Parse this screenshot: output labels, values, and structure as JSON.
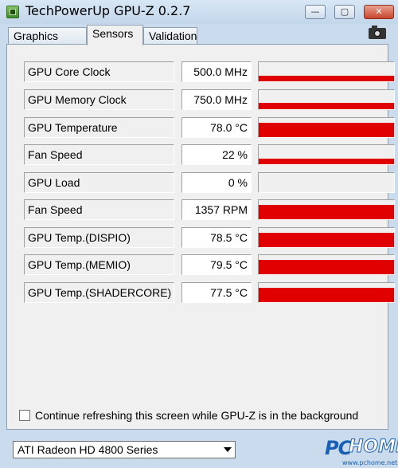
{
  "window": {
    "title": "TechPowerUp GPU-Z 0.2.7",
    "controls": {
      "minimize": "—",
      "maximize": "▢",
      "close": "✕"
    }
  },
  "tabs": [
    {
      "label": "Graphics Card",
      "active": false
    },
    {
      "label": "Sensors",
      "active": true
    },
    {
      "label": "Validation",
      "active": false
    }
  ],
  "icons": {
    "app": "gpu-z-app-icon",
    "screenshot": "camera-icon"
  },
  "sensors": [
    {
      "label": "GPU Core Clock",
      "value": "500.0 MHz",
      "graph_level": 0.3
    },
    {
      "label": "GPU Memory Clock",
      "value": "750.0 MHz",
      "graph_level": 0.35
    },
    {
      "label": "GPU Temperature",
      "value": "78.0 °C",
      "graph_level": 0.75
    },
    {
      "label": "Fan Speed",
      "value": "22 %",
      "graph_level": 0.3
    },
    {
      "label": "GPU Load",
      "value": "0 %",
      "graph_level": 0
    },
    {
      "label": "Fan Speed",
      "value": "1357 RPM",
      "graph_level": 0.75
    },
    {
      "label": "GPU Temp.(DISPIO)",
      "value": "78.5 °C",
      "graph_level": 0.75
    },
    {
      "label": "GPU Temp.(MEMIO)",
      "value": "79.5 °C",
      "graph_level": 0.75
    },
    {
      "label": "GPU Temp.(SHADERCORE)",
      "value": "77.5 °C",
      "graph_level": 0.75
    }
  ],
  "graph_color": "#e00000",
  "background_refresh": {
    "label": "Continue refreshing this screen while GPU-Z is in the background",
    "checked": false
  },
  "card_select": {
    "value": "ATI Radeon HD 4800 Series"
  },
  "watermark": {
    "pc": "PC",
    "home": "HOME",
    "url": "www.pchome.net"
  }
}
